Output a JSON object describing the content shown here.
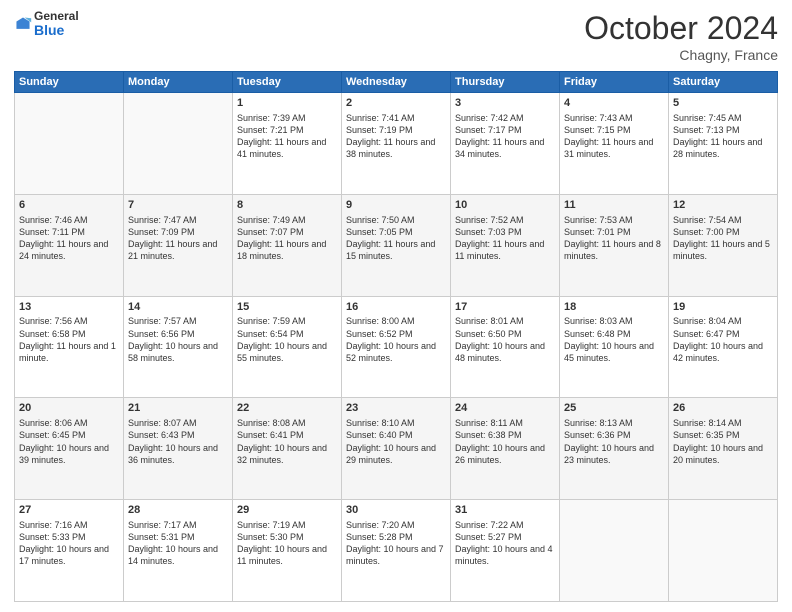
{
  "header": {
    "logo_general": "General",
    "logo_blue": "Blue",
    "month": "October 2024",
    "location": "Chagny, France"
  },
  "weekdays": [
    "Sunday",
    "Monday",
    "Tuesday",
    "Wednesday",
    "Thursday",
    "Friday",
    "Saturday"
  ],
  "weeks": [
    [
      {
        "day": "",
        "sunrise": "",
        "sunset": "",
        "daylight": ""
      },
      {
        "day": "",
        "sunrise": "",
        "sunset": "",
        "daylight": ""
      },
      {
        "day": "1",
        "sunrise": "Sunrise: 7:39 AM",
        "sunset": "Sunset: 7:21 PM",
        "daylight": "Daylight: 11 hours and 41 minutes."
      },
      {
        "day": "2",
        "sunrise": "Sunrise: 7:41 AM",
        "sunset": "Sunset: 7:19 PM",
        "daylight": "Daylight: 11 hours and 38 minutes."
      },
      {
        "day": "3",
        "sunrise": "Sunrise: 7:42 AM",
        "sunset": "Sunset: 7:17 PM",
        "daylight": "Daylight: 11 hours and 34 minutes."
      },
      {
        "day": "4",
        "sunrise": "Sunrise: 7:43 AM",
        "sunset": "Sunset: 7:15 PM",
        "daylight": "Daylight: 11 hours and 31 minutes."
      },
      {
        "day": "5",
        "sunrise": "Sunrise: 7:45 AM",
        "sunset": "Sunset: 7:13 PM",
        "daylight": "Daylight: 11 hours and 28 minutes."
      }
    ],
    [
      {
        "day": "6",
        "sunrise": "Sunrise: 7:46 AM",
        "sunset": "Sunset: 7:11 PM",
        "daylight": "Daylight: 11 hours and 24 minutes."
      },
      {
        "day": "7",
        "sunrise": "Sunrise: 7:47 AM",
        "sunset": "Sunset: 7:09 PM",
        "daylight": "Daylight: 11 hours and 21 minutes."
      },
      {
        "day": "8",
        "sunrise": "Sunrise: 7:49 AM",
        "sunset": "Sunset: 7:07 PM",
        "daylight": "Daylight: 11 hours and 18 minutes."
      },
      {
        "day": "9",
        "sunrise": "Sunrise: 7:50 AM",
        "sunset": "Sunset: 7:05 PM",
        "daylight": "Daylight: 11 hours and 15 minutes."
      },
      {
        "day": "10",
        "sunrise": "Sunrise: 7:52 AM",
        "sunset": "Sunset: 7:03 PM",
        "daylight": "Daylight: 11 hours and 11 minutes."
      },
      {
        "day": "11",
        "sunrise": "Sunrise: 7:53 AM",
        "sunset": "Sunset: 7:01 PM",
        "daylight": "Daylight: 11 hours and 8 minutes."
      },
      {
        "day": "12",
        "sunrise": "Sunrise: 7:54 AM",
        "sunset": "Sunset: 7:00 PM",
        "daylight": "Daylight: 11 hours and 5 minutes."
      }
    ],
    [
      {
        "day": "13",
        "sunrise": "Sunrise: 7:56 AM",
        "sunset": "Sunset: 6:58 PM",
        "daylight": "Daylight: 11 hours and 1 minute."
      },
      {
        "day": "14",
        "sunrise": "Sunrise: 7:57 AM",
        "sunset": "Sunset: 6:56 PM",
        "daylight": "Daylight: 10 hours and 58 minutes."
      },
      {
        "day": "15",
        "sunrise": "Sunrise: 7:59 AM",
        "sunset": "Sunset: 6:54 PM",
        "daylight": "Daylight: 10 hours and 55 minutes."
      },
      {
        "day": "16",
        "sunrise": "Sunrise: 8:00 AM",
        "sunset": "Sunset: 6:52 PM",
        "daylight": "Daylight: 10 hours and 52 minutes."
      },
      {
        "day": "17",
        "sunrise": "Sunrise: 8:01 AM",
        "sunset": "Sunset: 6:50 PM",
        "daylight": "Daylight: 10 hours and 48 minutes."
      },
      {
        "day": "18",
        "sunrise": "Sunrise: 8:03 AM",
        "sunset": "Sunset: 6:48 PM",
        "daylight": "Daylight: 10 hours and 45 minutes."
      },
      {
        "day": "19",
        "sunrise": "Sunrise: 8:04 AM",
        "sunset": "Sunset: 6:47 PM",
        "daylight": "Daylight: 10 hours and 42 minutes."
      }
    ],
    [
      {
        "day": "20",
        "sunrise": "Sunrise: 8:06 AM",
        "sunset": "Sunset: 6:45 PM",
        "daylight": "Daylight: 10 hours and 39 minutes."
      },
      {
        "day": "21",
        "sunrise": "Sunrise: 8:07 AM",
        "sunset": "Sunset: 6:43 PM",
        "daylight": "Daylight: 10 hours and 36 minutes."
      },
      {
        "day": "22",
        "sunrise": "Sunrise: 8:08 AM",
        "sunset": "Sunset: 6:41 PM",
        "daylight": "Daylight: 10 hours and 32 minutes."
      },
      {
        "day": "23",
        "sunrise": "Sunrise: 8:10 AM",
        "sunset": "Sunset: 6:40 PM",
        "daylight": "Daylight: 10 hours and 29 minutes."
      },
      {
        "day": "24",
        "sunrise": "Sunrise: 8:11 AM",
        "sunset": "Sunset: 6:38 PM",
        "daylight": "Daylight: 10 hours and 26 minutes."
      },
      {
        "day": "25",
        "sunrise": "Sunrise: 8:13 AM",
        "sunset": "Sunset: 6:36 PM",
        "daylight": "Daylight: 10 hours and 23 minutes."
      },
      {
        "day": "26",
        "sunrise": "Sunrise: 8:14 AM",
        "sunset": "Sunset: 6:35 PM",
        "daylight": "Daylight: 10 hours and 20 minutes."
      }
    ],
    [
      {
        "day": "27",
        "sunrise": "Sunrise: 7:16 AM",
        "sunset": "Sunset: 5:33 PM",
        "daylight": "Daylight: 10 hours and 17 minutes."
      },
      {
        "day": "28",
        "sunrise": "Sunrise: 7:17 AM",
        "sunset": "Sunset: 5:31 PM",
        "daylight": "Daylight: 10 hours and 14 minutes."
      },
      {
        "day": "29",
        "sunrise": "Sunrise: 7:19 AM",
        "sunset": "Sunset: 5:30 PM",
        "daylight": "Daylight: 10 hours and 11 minutes."
      },
      {
        "day": "30",
        "sunrise": "Sunrise: 7:20 AM",
        "sunset": "Sunset: 5:28 PM",
        "daylight": "Daylight: 10 hours and 7 minutes."
      },
      {
        "day": "31",
        "sunrise": "Sunrise: 7:22 AM",
        "sunset": "Sunset: 5:27 PM",
        "daylight": "Daylight: 10 hours and 4 minutes."
      },
      {
        "day": "",
        "sunrise": "",
        "sunset": "",
        "daylight": ""
      },
      {
        "day": "",
        "sunrise": "",
        "sunset": "",
        "daylight": ""
      }
    ]
  ]
}
